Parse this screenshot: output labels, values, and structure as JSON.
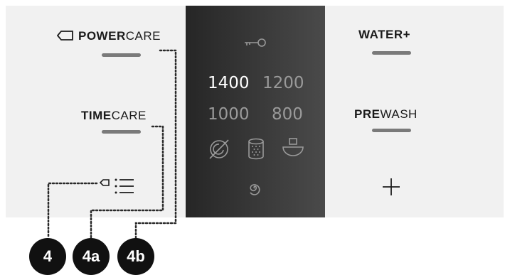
{
  "left_buttons": {
    "powercare": {
      "bold": "POWER",
      "normal": "CARE"
    },
    "timecare": {
      "bold": "TIME",
      "normal": "CARE"
    }
  },
  "right_buttons": {
    "water_plus": {
      "bold": "WATER+",
      "normal": ""
    },
    "prewash": {
      "bold": "PRE",
      "normal": "WASH"
    }
  },
  "spin_speeds": [
    "1400",
    "1200",
    "1000",
    "800"
  ],
  "selected_speed": "1400",
  "callouts": [
    "4",
    "4a",
    "4b"
  ],
  "icons": [
    "tag-icon",
    "key-lock-icon",
    "no-spin-icon",
    "drum-icon",
    "rinse-hold-icon",
    "spin-icon",
    "options-list-icon",
    "plus-icon"
  ],
  "colors": {
    "panel": "#f1f1f1",
    "display": "#333333",
    "badge": "#111111",
    "active_speed": "#ffffff",
    "inactive_speed": "#9a9a9a"
  }
}
